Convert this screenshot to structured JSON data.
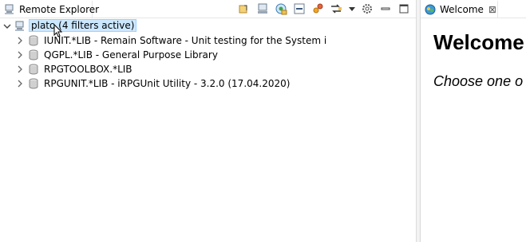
{
  "left_view": {
    "tab_label": "Remote Explorer",
    "toolbar_icons": [
      "go-up-icon",
      "system-icon",
      "new-connection-icon",
      "collapse-all-icon",
      "link-icon",
      "sync-icon",
      "view-menu-icon",
      "settings-icon",
      "minimize-icon",
      "maximize-icon"
    ]
  },
  "tree": {
    "root": {
      "label": "plato (4 filters active)",
      "expanded": true
    },
    "children": [
      {
        "label": "IUNIT.*LIB - Remain Software - Unit testing for the System i"
      },
      {
        "label": "QGPL.*LIB - General Purpose Library"
      },
      {
        "label": "RPGTOOLBOX.*LIB"
      },
      {
        "label": "RPGUNIT.*LIB - iRPGUnit Utility - 3.2.0 (17.04.2020)"
      }
    ]
  },
  "right_view": {
    "tab_label": "Welcome",
    "close_glyph": "⊠",
    "heading": "Welcome",
    "subheading": "Choose one o"
  },
  "colors": {
    "selection_bg": "#cce8ff",
    "selection_border": "#99d1ff"
  }
}
